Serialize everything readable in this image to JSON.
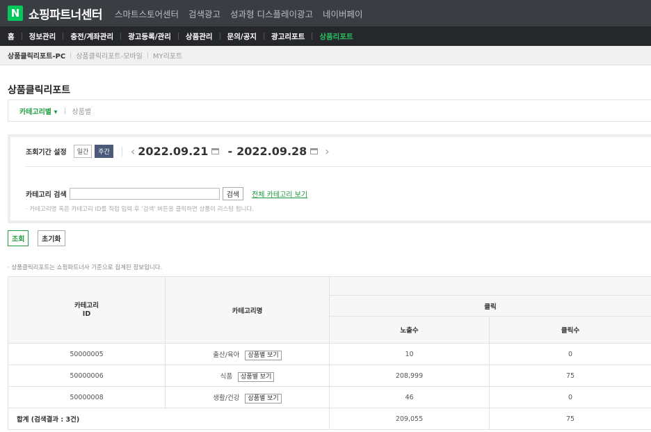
{
  "header": {
    "logo_letter": "N",
    "brand": "쇼핑파트너센터",
    "nav": [
      "스마트스토어센터",
      "검색광고",
      "성과형 디스플레이광고",
      "네이버페이"
    ]
  },
  "menu": [
    "홈",
    "정보관리",
    "충전/계좌관리",
    "광고등록/관리",
    "상품관리",
    "문의/공지",
    "광고리포트",
    "상품리포트"
  ],
  "subtabs": [
    "상품클릭리포트-PC",
    "상품클릭리포트-모바일",
    "MY리포트"
  ],
  "page_title": "상품클릭리포트",
  "view_tabs": {
    "category": "카테고리별 ▾",
    "product": "상품별"
  },
  "search": {
    "period_label": "조회기간 설정",
    "daily": "일간",
    "weekly": "주간",
    "start_date": "2022.09.21",
    "end_date": "2022.09.28",
    "category_label": "카테고리 검색",
    "category_value": "",
    "search_button": "검색",
    "all_link": "전체 카테고리 보기",
    "hint": "· 카테고리명 혹은 카테고리 ID를 직접 입력 후 '검색' 버튼을 클릭하면 상품이 리스팅 됩니다."
  },
  "actions": {
    "query": "조회",
    "reset": "초기화"
  },
  "notice": "· 상품클릭리포트는 쇼핑파트너사 기준으로 집계된 정보입니다.",
  "table": {
    "headers": {
      "cat_id": "카테고리\nID",
      "cat_name": "카테고리명",
      "click_group": "클릭",
      "impressions": "노출수",
      "clicks": "클릭수"
    },
    "product_button": "상품별 보기",
    "rows": [
      {
        "id": "50000005",
        "name": "출산/육아",
        "impressions": "10",
        "clicks": "0"
      },
      {
        "id": "50000006",
        "name": "식품",
        "impressions": "208,999",
        "clicks": "75"
      },
      {
        "id": "50000008",
        "name": "생활/건강",
        "impressions": "46",
        "clicks": "0"
      }
    ],
    "total": {
      "label": "합계 (검색결과 : 3건)",
      "impressions": "209,055",
      "clicks": "75"
    }
  }
}
